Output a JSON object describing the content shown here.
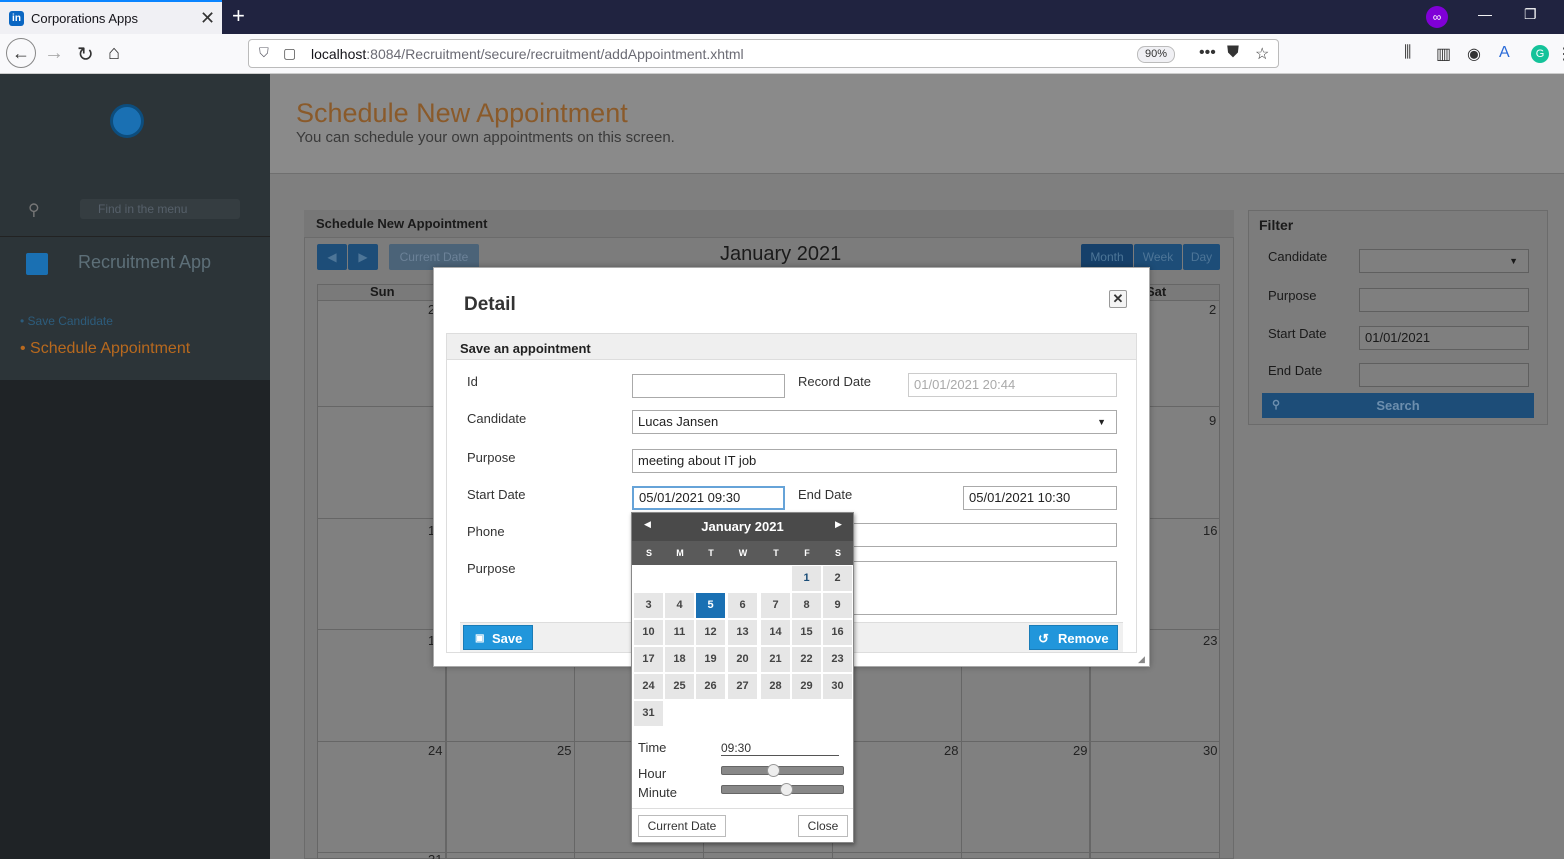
{
  "browser": {
    "tab_title": "Corporations Apps",
    "tab_favicon": "in",
    "url_host": "localhost",
    "url_rest": ":8084/Recruitment/secure/recruitment/addAppointment.xhtml",
    "zoom": "90%"
  },
  "sidebar": {
    "search_placeholder": "Find in the menu",
    "app_name": "Recruitment App",
    "items": [
      {
        "label": "• Save Candidate"
      },
      {
        "label": "• Schedule Appointment"
      }
    ]
  },
  "page": {
    "title": "Schedule New Appointment",
    "subtitle": "You can schedule your own appointments on this screen."
  },
  "calendar": {
    "panel_title": "Schedule New Appointment",
    "current_date_label": "Current Date",
    "month_label": "January 2021",
    "views": [
      "Month",
      "Week",
      "Day"
    ],
    "col_sun": "Sun",
    "col_sat": "Sat",
    "right_col_days": [
      "2",
      "9",
      "16",
      "23",
      "30"
    ],
    "left_col_days": [
      "2",
      "1",
      "1",
      "24"
    ],
    "row5_days": [
      "25",
      "28",
      "29"
    ],
    "last_row_partial": "31"
  },
  "filter": {
    "title": "Filter",
    "candidate_label": "Candidate",
    "purpose_label": "Purpose",
    "start_label": "Start Date",
    "start_value": "01/01/2021",
    "end_label": "End Date",
    "search_label": "Search"
  },
  "dialog": {
    "title": "Detail",
    "fieldset_title": "Save an appointment",
    "id_label": "Id",
    "id_value": "",
    "record_date_label": "Record Date",
    "record_date_value": "01/01/2021 20:44",
    "candidate_label": "Candidate",
    "candidate_value": "Lucas Jansen",
    "purpose_label": "Purpose",
    "purpose_value": "meeting about IT job",
    "start_label": "Start Date",
    "start_value": "05/01/2021 09:30",
    "end_label": "End Date",
    "end_value": "05/01/2021 10:30",
    "phone_label": "Phone",
    "purpose2_label": "Purpose",
    "save_label": "Save",
    "remove_label": "Remove"
  },
  "datepicker": {
    "month": "January 2021",
    "dow": [
      "S",
      "M",
      "T",
      "W",
      "T",
      "F",
      "S"
    ],
    "weeks": [
      [
        "",
        "",
        "",
        "",
        "",
        "1",
        "2"
      ],
      [
        "3",
        "4",
        "5",
        "6",
        "7",
        "8",
        "9"
      ],
      [
        "10",
        "11",
        "12",
        "13",
        "14",
        "15",
        "16"
      ],
      [
        "17",
        "18",
        "19",
        "20",
        "21",
        "22",
        "23"
      ],
      [
        "24",
        "25",
        "26",
        "27",
        "28",
        "29",
        "30"
      ],
      [
        "31",
        "",
        "",
        "",
        "",
        "",
        ""
      ]
    ],
    "selected": "5",
    "today": "1",
    "time_label": "Time",
    "time_value": "09:30",
    "hour_label": "Hour",
    "minute_label": "Minute",
    "hour_level": 0.39,
    "minute_level": 0.5,
    "current_date_label": "Current Date",
    "close_label": "Close"
  }
}
